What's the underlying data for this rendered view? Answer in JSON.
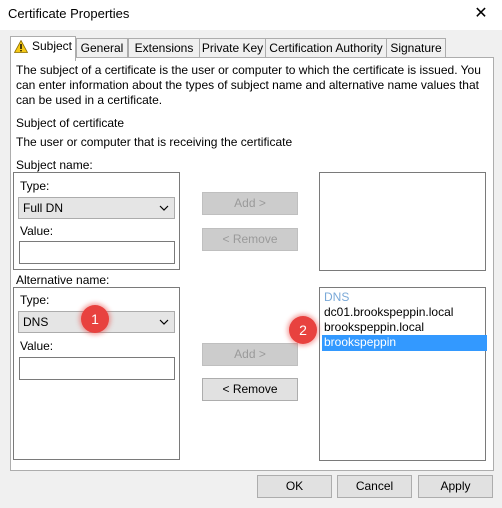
{
  "window": {
    "title": "Certificate Properties",
    "close_glyph": "✕"
  },
  "tabs": [
    {
      "label": "Subject",
      "icon": "warning-icon",
      "active": true
    },
    {
      "label": "General"
    },
    {
      "label": "Extensions"
    },
    {
      "label": "Private Key"
    },
    {
      "label": "Certification Authority"
    },
    {
      "label": "Signature"
    }
  ],
  "intro": "The subject of a certificate is the user or computer to which the certificate is issued. You can enter information about the types of subject name and alternative name values that can be used in a certificate.",
  "subject_of_certificate": {
    "heading": "Subject of certificate",
    "description": "The user or computer that is receiving the certificate"
  },
  "subject_name": {
    "group_label": "Subject name:",
    "type_label": "Type:",
    "type_value": "Full DN",
    "value_label": "Value:",
    "value": "",
    "add_button": "Add >",
    "remove_button": "< Remove"
  },
  "alternative_name": {
    "group_label": "Alternative name:",
    "type_label": "Type:",
    "type_value": "DNS",
    "value_label": "Value:",
    "value": "",
    "add_button": "Add >",
    "remove_button": "< Remove",
    "list": {
      "header": "DNS",
      "items": [
        "dc01.brookspeppin.local",
        "brookspeppin.local",
        "brookspeppin"
      ],
      "selected_index": 2
    }
  },
  "annotations": [
    "1",
    "2"
  ],
  "footer": {
    "ok": "OK",
    "cancel": "Cancel",
    "apply": "Apply"
  },
  "colors": {
    "selection": "#3399ff",
    "badge": "#e8423f",
    "list_header": "#7aa9d8"
  }
}
